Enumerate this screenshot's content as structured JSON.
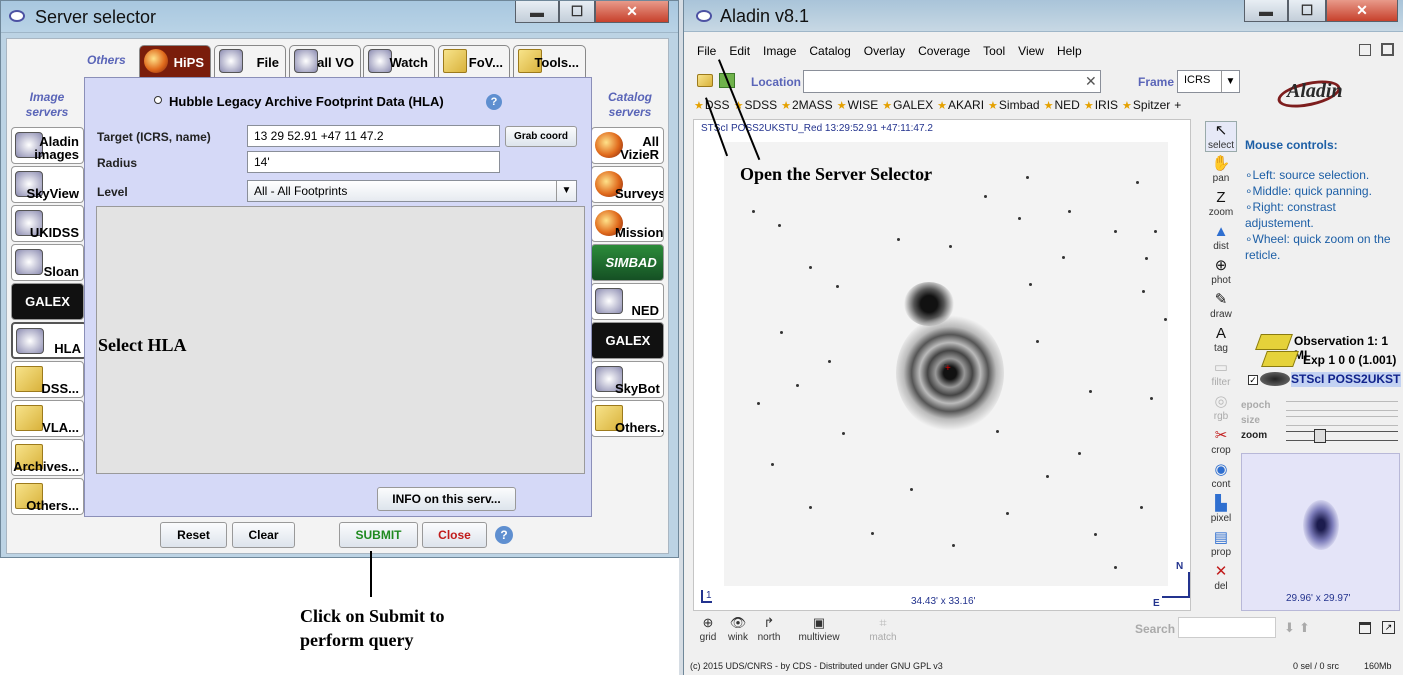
{
  "server_selector": {
    "title": "Server selector",
    "window_buttons": {
      "minimize": "▬",
      "maximize": "☐",
      "close": "✕"
    },
    "others_label": "Others",
    "image_servers_label": "Image\nservers",
    "catalog_servers_label": "Catalog\nservers",
    "top_tabs": [
      {
        "label": "HiPS",
        "icon": "hips-icon"
      },
      {
        "label": "File",
        "icon": "file-icon"
      },
      {
        "label": "all VO",
        "icon": "vo-icon"
      },
      {
        "label": "Watch",
        "icon": "watch-icon"
      },
      {
        "label": "FoV...",
        "icon": "folder-icon"
      },
      {
        "label": "Tools...",
        "icon": "folder-icon"
      }
    ],
    "image_servers": [
      {
        "label": "Aladin images",
        "icon": "aladin-icon"
      },
      {
        "label": "SkyView",
        "icon": "skyview-icon"
      },
      {
        "label": "UKIDSS",
        "icon": "ukidss-icon"
      },
      {
        "label": "Sloan",
        "icon": "sloan-icon"
      },
      {
        "label": "GALEX",
        "icon": "galex-icon"
      },
      {
        "label": "HLA",
        "icon": "hla-icon"
      },
      {
        "label": "DSS...",
        "icon": "folder-icon"
      },
      {
        "label": "VLA...",
        "icon": "folder-icon"
      },
      {
        "label": "Archives...",
        "icon": "folder-icon"
      },
      {
        "label": "Others...",
        "icon": "folder-icon"
      }
    ],
    "catalog_servers": [
      {
        "label": "All VizieR",
        "icon": "vizier-icon"
      },
      {
        "label": "Surveys",
        "icon": "surveys-icon"
      },
      {
        "label": "Missions",
        "icon": "missions-icon"
      },
      {
        "label": "SIMBAD",
        "icon": "simbad-icon"
      },
      {
        "label": "NED",
        "icon": "ned-icon"
      },
      {
        "label": "GALEX",
        "icon": "galex-icon"
      },
      {
        "label": "SkyBot",
        "icon": "skybot-icon"
      },
      {
        "label": "Others..",
        "icon": "folder-icon"
      }
    ],
    "form": {
      "heading": "Hubble Legacy Archive Footprint Data (HLA)",
      "target_label": "Target (ICRS, name)",
      "target_value": "13 29 52.91 +47 11 47.2",
      "grab_coord": "Grab coord",
      "radius_label": "Radius",
      "radius_value": "14'",
      "level_label": "Level",
      "level_value": "All - All Footprints",
      "info_button": "INFO on this serv...",
      "annotation": "Select HLA"
    },
    "bottom_buttons": {
      "reset": "Reset",
      "clear": "Clear",
      "submit": "SUBMIT",
      "close": "Close",
      "help": "?"
    },
    "colors": {
      "submit": "#1f8a1f",
      "close": "#c11b1b",
      "panel": "#d5d9f7"
    }
  },
  "annotations": {
    "submit_note_line1": "Click on Submit to",
    "submit_note_line2": "perform query",
    "open_server_selector": "Open the Server Selector"
  },
  "aladin": {
    "title": "Aladin v8.1",
    "window_buttons": {
      "minimize": "▬",
      "maximize": "☐",
      "close": "✕"
    },
    "menu": [
      "File",
      "Edit",
      "Image",
      "Catalog",
      "Overlay",
      "Coverage",
      "Tool",
      "View",
      "Help"
    ],
    "location_label": "Location",
    "location_value": "",
    "frame_label": "Frame",
    "frame_value": "ICRS",
    "shortcuts": [
      "DSS",
      "SDSS",
      "2MASS",
      "WISE",
      "GALEX",
      "AKARI",
      "Simbad",
      "NED",
      "IRIS",
      "Spitzer",
      "+"
    ],
    "image_label": "STScI POSS2UKSTU_Red 13:29:52.91 +47:11:47.2",
    "field_size": "34.43' x 33.16'",
    "compass_n": "N",
    "compass_e": "E",
    "tools": [
      {
        "label": "select",
        "icon": "pointer-icon"
      },
      {
        "label": "pan",
        "icon": "hand-icon"
      },
      {
        "label": "zoom",
        "icon": "zoom-icon"
      },
      {
        "label": "dist",
        "icon": "dist-icon"
      },
      {
        "label": "phot",
        "icon": "phot-icon"
      },
      {
        "label": "draw",
        "icon": "pencil-icon"
      },
      {
        "label": "tag",
        "icon": "tag-icon"
      },
      {
        "label": "filter",
        "icon": "filter-icon"
      },
      {
        "label": "rgb",
        "icon": "rgb-icon"
      },
      {
        "label": "crop",
        "icon": "crop-icon"
      },
      {
        "label": "cont",
        "icon": "cont-icon"
      },
      {
        "label": "pixel",
        "icon": "pixel-icon"
      },
      {
        "label": "prop",
        "icon": "prop-icon"
      },
      {
        "label": "del",
        "icon": "delete-icon"
      }
    ],
    "mouse_controls": {
      "title": "Mouse controls:",
      "lines": [
        "∘Left: source selection.",
        "∘Middle: quick panning.",
        "∘Right: constrast",
        "adjustement.",
        "∘Wheel: quick zoom on the",
        "reticle."
      ]
    },
    "stack": {
      "plane1": "Observation 1: 1 MI",
      "plane2": "Exp 1 0 0  (1.001)",
      "plane3": "STScI POSS2UKST"
    },
    "sliders": {
      "epoch": "epoch",
      "size": "size",
      "zoom": "zoom"
    },
    "zoom_view_size": "29.96' x 29.97'",
    "bottom_tools": [
      "grid",
      "wink",
      "north",
      "multiview",
      "match"
    ],
    "search_label": "Search",
    "status_left": "(c) 2015 UDS/CNRS - by CDS - Distributed under GNU GPL v3",
    "status_sel": "0 sel / 0 src",
    "status_mem": "160Mb",
    "frame_number": "1"
  }
}
